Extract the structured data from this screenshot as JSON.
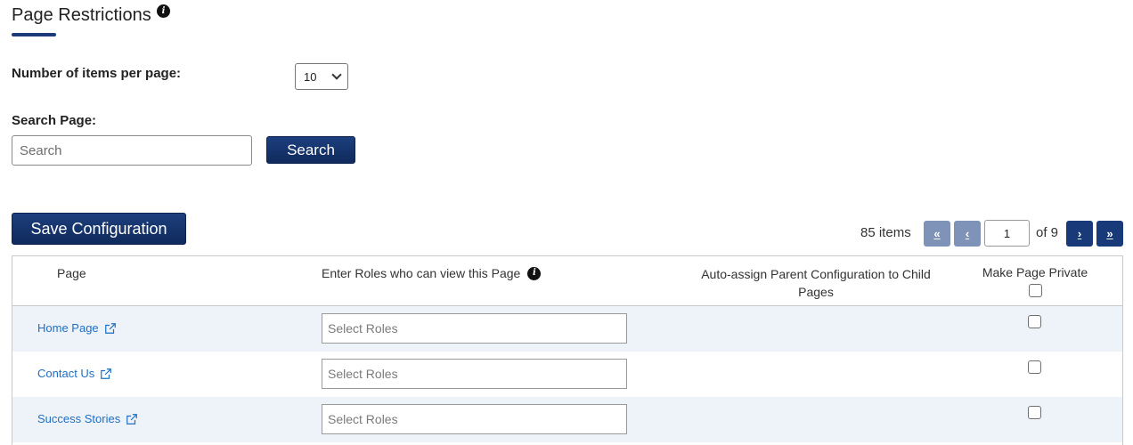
{
  "page": {
    "title": "Page Restrictions"
  },
  "settings": {
    "items_per_page_label": "Number of items per page:",
    "items_per_page_value": "10",
    "search_label": "Search Page:",
    "search_placeholder": "Search",
    "search_button": "Search"
  },
  "toolbar": {
    "save_label": "Save Configuration"
  },
  "pagination": {
    "items_text": "85 items",
    "first": "«",
    "prev": "‹",
    "current_page": "1",
    "of_text": "of 9",
    "next": "›",
    "last": "»"
  },
  "table": {
    "headers": {
      "page": "Page",
      "roles": "Enter Roles who can view this Page",
      "auto_assign": "Auto-assign Parent Configuration to Child Pages",
      "private": "Make Page Private"
    },
    "rows": [
      {
        "page": "Home Page",
        "roles_placeholder": "Select Roles",
        "private": false
      },
      {
        "page": "Contact Us",
        "roles_placeholder": "Select Roles",
        "private": false
      },
      {
        "page": "Success Stories",
        "roles_placeholder": "Select Roles",
        "private": false
      }
    ]
  },
  "colors": {
    "primary": "#183a78",
    "link": "#1f6fc4",
    "row_alt": "#eef3fa"
  }
}
